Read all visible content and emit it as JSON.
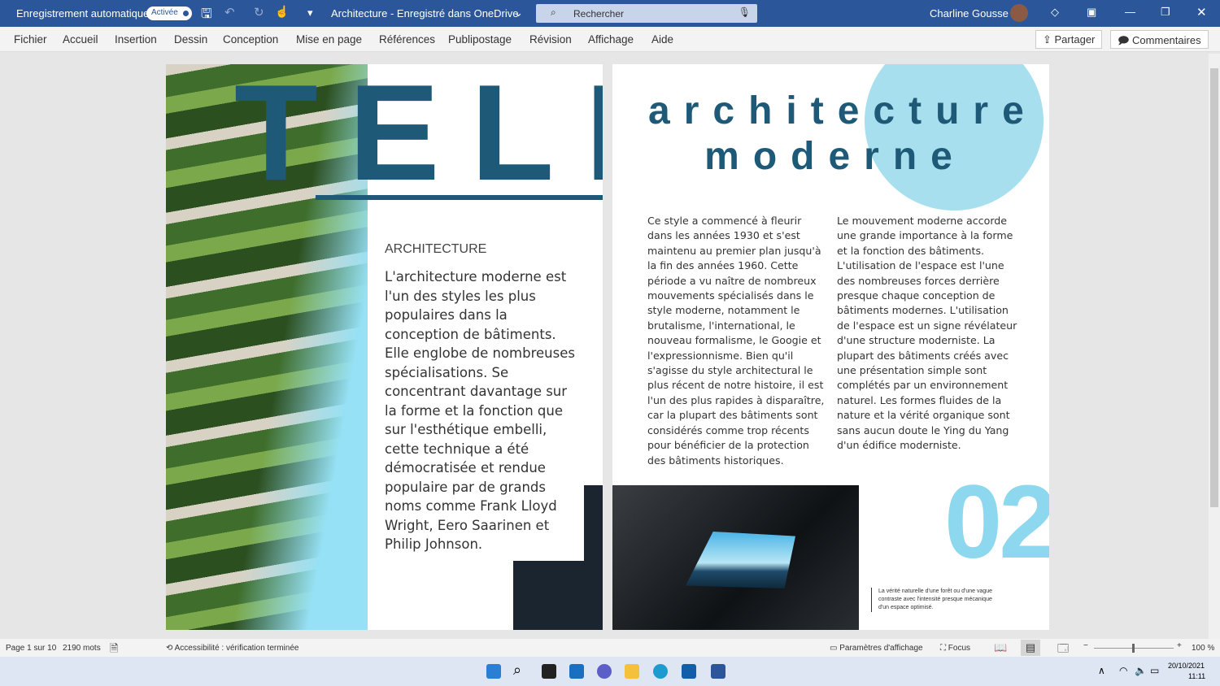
{
  "titlebar": {
    "autosave_label": "Enregistrement automatique",
    "autosave_state": "Activée",
    "doc_title": "Architecture - Enregistré dans OneDrive",
    "search_placeholder": "Rechercher",
    "user": "Charline Gousse"
  },
  "menu": {
    "items": [
      "Fichier",
      "Accueil",
      "Insertion",
      "Dessin",
      "Conception",
      "Mise en page",
      "Références",
      "Publipostage",
      "Révision",
      "Affichage",
      "Aide"
    ],
    "share": "Partager",
    "comments": "Commentaires"
  },
  "page1": {
    "big_title": "TELL",
    "kicker": "ARCHITECTURE",
    "body": "L'architecture moderne est l'un des styles les plus populaires dans la conception de bâtiments. Elle englobe de nombreuses spécialisations. Se concentrant davantage sur la forme et la fonction que sur l'esthétique embelli, cette technique a été démocratisée et rendue populaire par de grands noms comme Frank Lloyd Wright, Eero Saarinen et Philip Johnson."
  },
  "page2": {
    "title_line1": "architecture",
    "title_line2": "moderne",
    "col1": "Ce style a commencé à fleurir dans les années 1930 et s'est maintenu au premier plan jusqu'à la fin des années 1960. Cette période a vu naître de nombreux mouvements spécialisés dans le style moderne, notamment le brutalisme, l'international, le nouveau formalisme, le Googie et l'expressionnisme. Bien qu'il s'agisse du style architectural le plus récent de notre histoire, il est l'un des plus rapides à disparaître, car la plupart des bâtiments sont considérés comme trop récents pour bénéficier de la protection des bâtiments historiques.",
    "col2": "Le mouvement moderne accorde une grande importance à la forme et la fonction des bâtiments. L'utilisation de l'espace est l'une des nombreuses forces derrière presque chaque conception de bâtiments modernes. L'utilisation de l'espace est un signe révélateur d'une structure moderniste. La plupart des bâtiments créés avec une présentation simple sont complétés par un environnement naturel. Les formes fluides de la nature et la vérité organique sont sans aucun doute le Ying du Yang d'un édifice moderniste.",
    "number": "02",
    "caption": "La vérité naturelle d'une forêt ou d'une vague contraste avec l'intensité presque mécanique d'un espace optimisé."
  },
  "status": {
    "page": "Page 1 sur 10",
    "words": "2190 mots",
    "accessibility": "Accessibilité : vérification terminée",
    "display_settings": "Paramètres d'affichage",
    "focus": "Focus",
    "zoom": "100 %"
  },
  "taskbar": {
    "date": "20/10/2021",
    "time": "11:11"
  },
  "colors": {
    "accent": "#2b579a",
    "title_teal": "#1e5a78",
    "cyan": "#9be3f2"
  }
}
